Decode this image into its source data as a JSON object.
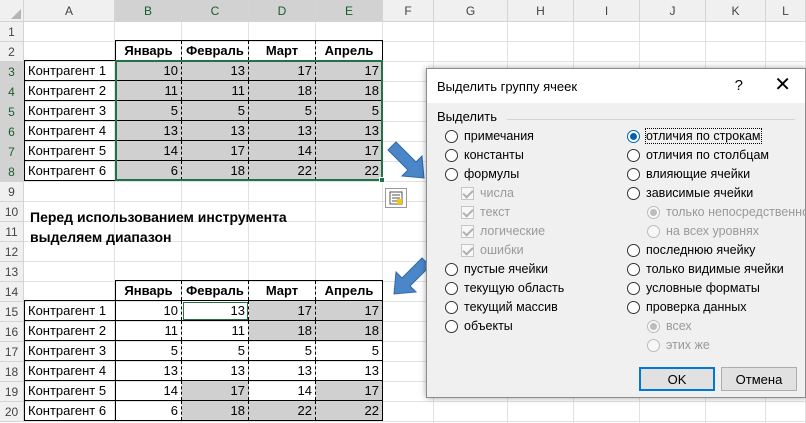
{
  "columns": [
    "A",
    "B",
    "C",
    "D",
    "E",
    "F",
    "G",
    "H",
    "I",
    "J",
    "K",
    "L"
  ],
  "rows": [
    "1",
    "2",
    "3",
    "4",
    "5",
    "6",
    "7",
    "8",
    "9",
    "10",
    "11",
    "12",
    "13",
    "14",
    "15",
    "16",
    "17",
    "18",
    "19",
    "20"
  ],
  "table1": {
    "headers": [
      "Январь",
      "Февраль",
      "Март",
      "Апрель"
    ],
    "rows": [
      {
        "label": "Контрагент 1",
        "values": [
          "10",
          "13",
          "17",
          "17"
        ]
      },
      {
        "label": "Контрагент 2",
        "values": [
          "11",
          "11",
          "18",
          "18"
        ]
      },
      {
        "label": "Контрагент 3",
        "values": [
          "5",
          "5",
          "5",
          "5"
        ]
      },
      {
        "label": "Контрагент 4",
        "values": [
          "13",
          "13",
          "13",
          "13"
        ]
      },
      {
        "label": "Контрагент 5",
        "values": [
          "14",
          "17",
          "14",
          "17"
        ]
      },
      {
        "label": "Контрагент 6",
        "values": [
          "6",
          "18",
          "22",
          "22"
        ]
      }
    ]
  },
  "note": {
    "line1": "Перед использованием инструмента",
    "line2": "выделяем диапазон"
  },
  "table2": {
    "headers": [
      "Январь",
      "Февраль",
      "Март",
      "Апрель"
    ],
    "rows": [
      {
        "label": "Контрагент 1",
        "values": [
          "10",
          "13",
          "17",
          "17"
        ]
      },
      {
        "label": "Контрагент 2",
        "values": [
          "11",
          "11",
          "18",
          "18"
        ]
      },
      {
        "label": "Контрагент 3",
        "values": [
          "5",
          "5",
          "5",
          "5"
        ]
      },
      {
        "label": "Контрагент 4",
        "values": [
          "13",
          "13",
          "13",
          "13"
        ]
      },
      {
        "label": "Контрагент 5",
        "values": [
          "14",
          "17",
          "14",
          "17"
        ]
      },
      {
        "label": "Контрагент 6",
        "values": [
          "6",
          "18",
          "22",
          "22"
        ]
      }
    ]
  },
  "dialog": {
    "title": "Выделить группу ячеек",
    "help": "?",
    "close": "✕",
    "group_label": "Выделить",
    "left_options": [
      {
        "label": "примечания",
        "type": "radio",
        "selected": false,
        "enabled": true
      },
      {
        "label": "константы",
        "type": "radio",
        "selected": false,
        "enabled": true
      },
      {
        "label": "формулы",
        "type": "radio",
        "selected": false,
        "enabled": true
      },
      {
        "label": "числа",
        "type": "check",
        "selected": true,
        "enabled": false
      },
      {
        "label": "текст",
        "type": "check",
        "selected": true,
        "enabled": false
      },
      {
        "label": "логические",
        "type": "check",
        "selected": true,
        "enabled": false
      },
      {
        "label": "ошибки",
        "type": "check",
        "selected": true,
        "enabled": false
      },
      {
        "label": "пустые ячейки",
        "type": "radio",
        "selected": false,
        "enabled": true
      },
      {
        "label": "текущую область",
        "type": "radio",
        "selected": false,
        "enabled": true
      },
      {
        "label": "текущий массив",
        "type": "radio",
        "selected": false,
        "enabled": true
      },
      {
        "label": "объекты",
        "type": "radio",
        "selected": false,
        "enabled": true
      }
    ],
    "right_options": [
      {
        "label": "отличия по строкам",
        "type": "radio",
        "selected": true,
        "enabled": true
      },
      {
        "label": "отличия по столбцам",
        "type": "radio",
        "selected": false,
        "enabled": true
      },
      {
        "label": "влияющие ячейки",
        "type": "radio",
        "selected": false,
        "enabled": true
      },
      {
        "label": "зависимые ячейки",
        "type": "radio",
        "selected": false,
        "enabled": true
      },
      {
        "label": "только непосредственно",
        "type": "radio",
        "selected": true,
        "enabled": false
      },
      {
        "label": "на всех уровнях",
        "type": "radio",
        "selected": false,
        "enabled": false
      },
      {
        "label": "последнюю ячейку",
        "type": "radio",
        "selected": false,
        "enabled": true
      },
      {
        "label": "только видимые ячейки",
        "type": "radio",
        "selected": false,
        "enabled": true
      },
      {
        "label": "условные форматы",
        "type": "radio",
        "selected": false,
        "enabled": true
      },
      {
        "label": "проверка данных",
        "type": "radio",
        "selected": false,
        "enabled": true
      },
      {
        "label": "всех",
        "type": "radio",
        "selected": true,
        "enabled": false
      },
      {
        "label": "этих же",
        "type": "radio",
        "selected": false,
        "enabled": false
      }
    ],
    "ok": "OK",
    "cancel": "Отмена"
  }
}
